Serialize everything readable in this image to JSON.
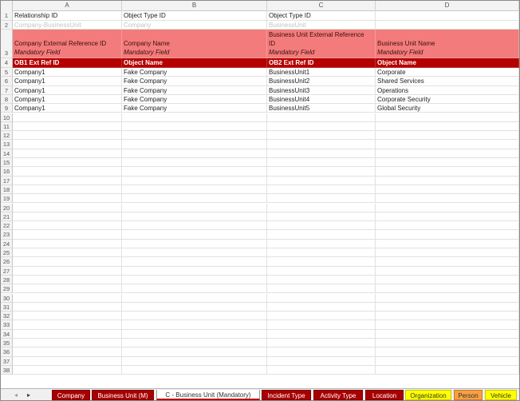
{
  "columns": [
    "A",
    "B",
    "C",
    "D"
  ],
  "row1": {
    "num": "1",
    "a": "Relationship ID",
    "b": "Object Type ID",
    "c": "Object Type ID",
    "d": ""
  },
  "row2": {
    "num": "2",
    "a": "Company-BusinessUnit",
    "b": "Company",
    "c": "BusinessUnit",
    "d": ""
  },
  "row3": {
    "num": "3",
    "a_line2": "Company External Reference ID",
    "a_line3": "Mandatory Field",
    "b_line2": "Company Name",
    "b_line3": "Mandatory Field",
    "c_line1": "Business Unit External Reference",
    "c_line2": "ID",
    "c_line3": "Mandatory Field",
    "d_line2": "Business Unit Name",
    "d_line3": "Mandatory Field"
  },
  "row4": {
    "num": "4",
    "a": "OB1 Ext Ref ID",
    "b": "Object Name",
    "c": "OB2 Ext Ref ID",
    "d": "Object Name"
  },
  "data_rows": [
    {
      "num": "5",
      "a": "Company1",
      "b": "Fake Company",
      "c": "BusinessUnit1",
      "d": "Corporate"
    },
    {
      "num": "6",
      "a": "Company1",
      "b": "Fake Company",
      "c": "BusinessUnit2",
      "d": "Shared Services"
    },
    {
      "num": "7",
      "a": "Company1",
      "b": "Fake Company",
      "c": "BusinessUnit3",
      "d": "Operations"
    },
    {
      "num": "8",
      "a": "Company1",
      "b": "Fake Company",
      "c": "BusinessUnit4",
      "d": "Corporate Security"
    },
    {
      "num": "9",
      "a": "Company1",
      "b": "Fake Company",
      "c": "BusinessUnit5",
      "d": "Global Security"
    }
  ],
  "empty_row_numbers": [
    "10",
    "11",
    "12",
    "13",
    "14",
    "15",
    "16",
    "17",
    "18",
    "19",
    "20",
    "21",
    "22",
    "23",
    "24",
    "25",
    "26",
    "27",
    "28",
    "29",
    "30",
    "31",
    "32",
    "33",
    "34",
    "35",
    "36",
    "37",
    "38"
  ],
  "sheet_nav": {
    "prev": "◂",
    "next": "▸"
  },
  "tabs": [
    {
      "label": "Company",
      "style": "red"
    },
    {
      "label": "Business Unit (M)",
      "style": "red"
    },
    {
      "label": "C - Business Unit (Mandatory)",
      "style": "active"
    },
    {
      "label": "Incident Type",
      "style": "red"
    },
    {
      "label": "Activity Type",
      "style": "red"
    },
    {
      "label": "Location",
      "style": "red"
    },
    {
      "label": "Organization",
      "style": "yellow"
    },
    {
      "label": "Person",
      "style": "orange"
    },
    {
      "label": "Vehicle",
      "style": "yellow"
    }
  ],
  "colors": {
    "header_fill": "#f47b7b",
    "tag_fill": "#b50000",
    "tab_red": "#a80000",
    "tab_yellow": "#ffff00",
    "tab_orange": "#f7a042"
  }
}
